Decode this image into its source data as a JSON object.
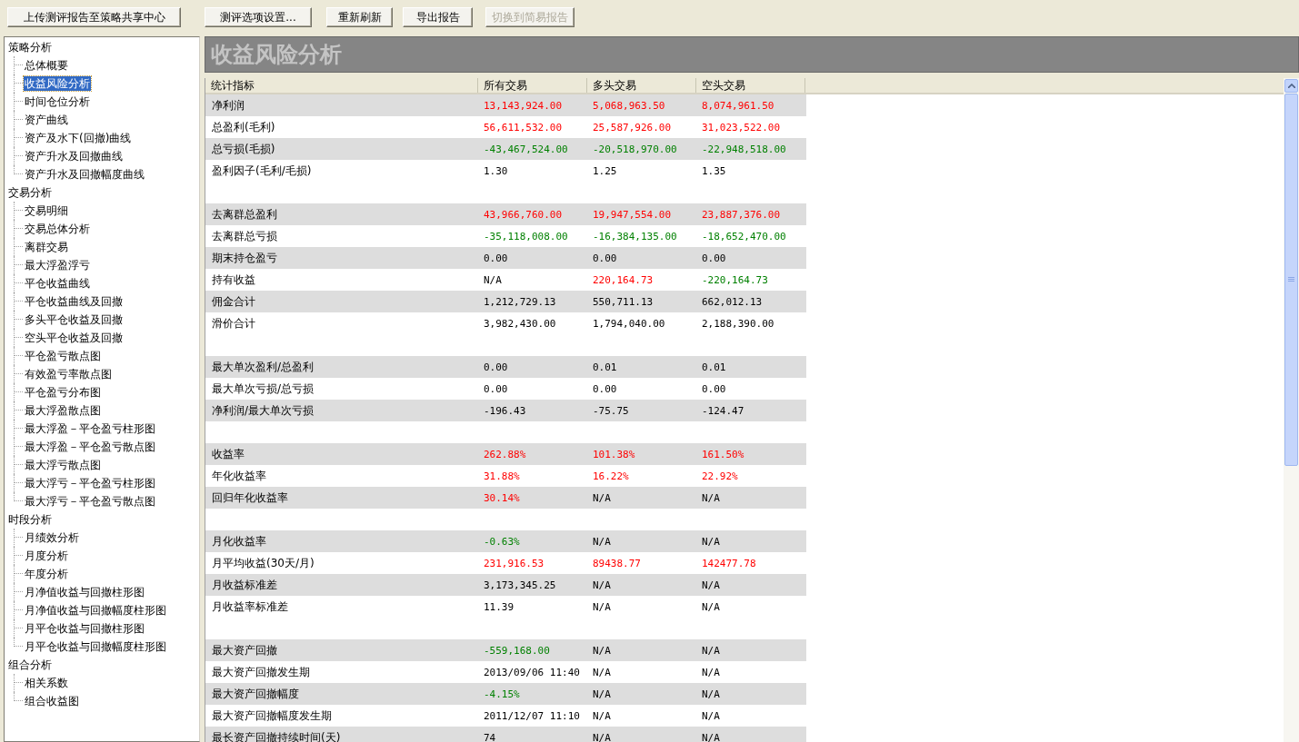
{
  "toolbar": {
    "buttons": [
      {
        "label": "上传测评报告至策略共享中心",
        "disabled": false
      },
      {
        "label": "测评选项设置...",
        "disabled": false
      },
      {
        "label": "重新刷新",
        "disabled": false
      },
      {
        "label": "导出报告",
        "disabled": false
      },
      {
        "label": "切换到简易报告",
        "disabled": true
      }
    ]
  },
  "sidebar": {
    "items": [
      {
        "label": "策略分析",
        "selected": false,
        "children": [
          {
            "label": "总体概要",
            "selected": false
          },
          {
            "label": "收益风险分析",
            "selected": true
          },
          {
            "label": "时间仓位分析",
            "selected": false
          },
          {
            "label": "资产曲线",
            "selected": false
          },
          {
            "label": "资产及水下(回撤)曲线",
            "selected": false
          },
          {
            "label": "资产升水及回撤曲线",
            "selected": false
          },
          {
            "label": "资产升水及回撤幅度曲线",
            "selected": false
          }
        ]
      },
      {
        "label": "交易分析",
        "selected": false,
        "children": [
          {
            "label": "交易明细",
            "selected": false
          },
          {
            "label": "交易总体分析",
            "selected": false
          },
          {
            "label": "离群交易",
            "selected": false
          },
          {
            "label": "最大浮盈浮亏",
            "selected": false
          },
          {
            "label": "平仓收益曲线",
            "selected": false
          },
          {
            "label": "平仓收益曲线及回撤",
            "selected": false
          },
          {
            "label": "多头平仓收益及回撤",
            "selected": false
          },
          {
            "label": "空头平仓收益及回撤",
            "selected": false
          },
          {
            "label": "平仓盈亏散点图",
            "selected": false
          },
          {
            "label": "有效盈亏率散点图",
            "selected": false
          },
          {
            "label": "平仓盈亏分布图",
            "selected": false
          },
          {
            "label": "最大浮盈散点图",
            "selected": false
          },
          {
            "label": "最大浮盈－平仓盈亏柱形图",
            "selected": false
          },
          {
            "label": "最大浮盈－平仓盈亏散点图",
            "selected": false
          },
          {
            "label": "最大浮亏散点图",
            "selected": false
          },
          {
            "label": "最大浮亏－平仓盈亏柱形图",
            "selected": false
          },
          {
            "label": "最大浮亏－平仓盈亏散点图",
            "selected": false
          }
        ]
      },
      {
        "label": "时段分析",
        "selected": false,
        "children": [
          {
            "label": "月绩效分析",
            "selected": false
          },
          {
            "label": "月度分析",
            "selected": false
          },
          {
            "label": "年度分析",
            "selected": false
          },
          {
            "label": "月净值收益与回撤柱形图",
            "selected": false
          },
          {
            "label": "月净值收益与回撤幅度柱形图",
            "selected": false
          },
          {
            "label": "月平仓收益与回撤柱形图",
            "selected": false
          },
          {
            "label": "月平仓收益与回撤幅度柱形图",
            "selected": false
          }
        ]
      },
      {
        "label": "组合分析",
        "selected": false,
        "children": [
          {
            "label": "相关系数",
            "selected": false
          },
          {
            "label": "组合收益图",
            "selected": false
          }
        ]
      }
    ]
  },
  "panel": {
    "title": "收益风险分析"
  },
  "table": {
    "columns": [
      "统计指标",
      "所有交易",
      "多头交易",
      "空头交易"
    ],
    "groups": [
      {
        "rows": [
          {
            "label": "净利润",
            "cells": [
              {
                "text": "13,143,924.00",
                "color": "#ff0000"
              },
              {
                "text": "5,068,963.50",
                "color": "#ff0000"
              },
              {
                "text": "8,074,961.50",
                "color": "#ff0000"
              }
            ]
          },
          {
            "label": "总盈利(毛利)",
            "cells": [
              {
                "text": "56,611,532.00",
                "color": "#ff0000"
              },
              {
                "text": "25,587,926.00",
                "color": "#ff0000"
              },
              {
                "text": "31,023,522.00",
                "color": "#ff0000"
              }
            ]
          },
          {
            "label": "总亏损(毛损)",
            "cells": [
              {
                "text": "-43,467,524.00",
                "color": "#008000"
              },
              {
                "text": "-20,518,970.00",
                "color": "#008000"
              },
              {
                "text": "-22,948,518.00",
                "color": "#008000"
              }
            ]
          },
          {
            "label": "盈利因子(毛利/毛损)",
            "cells": [
              {
                "text": "1.30",
                "color": "#000000"
              },
              {
                "text": "1.25",
                "color": "#000000"
              },
              {
                "text": "1.35",
                "color": "#000000"
              }
            ]
          }
        ]
      },
      {
        "rows": [
          {
            "label": "去离群总盈利",
            "cells": [
              {
                "text": "43,966,760.00",
                "color": "#ff0000"
              },
              {
                "text": "19,947,554.00",
                "color": "#ff0000"
              },
              {
                "text": "23,887,376.00",
                "color": "#ff0000"
              }
            ]
          },
          {
            "label": "去离群总亏损",
            "cells": [
              {
                "text": "-35,118,008.00",
                "color": "#008000"
              },
              {
                "text": "-16,384,135.00",
                "color": "#008000"
              },
              {
                "text": "-18,652,470.00",
                "color": "#008000"
              }
            ]
          },
          {
            "label": "期末持仓盈亏",
            "cells": [
              {
                "text": "0.00",
                "color": "#000000"
              },
              {
                "text": "0.00",
                "color": "#000000"
              },
              {
                "text": "0.00",
                "color": "#000000"
              }
            ]
          },
          {
            "label": "持有收益",
            "cells": [
              {
                "text": "N/A",
                "color": "#000000"
              },
              {
                "text": "220,164.73",
                "color": "#ff0000"
              },
              {
                "text": "-220,164.73",
                "color": "#008000"
              }
            ]
          },
          {
            "label": "佣金合计",
            "cells": [
              {
                "text": "1,212,729.13",
                "color": "#000000"
              },
              {
                "text": "550,711.13",
                "color": "#000000"
              },
              {
                "text": "662,012.13",
                "color": "#000000"
              }
            ]
          },
          {
            "label": "滑价合计",
            "cells": [
              {
                "text": "3,982,430.00",
                "color": "#000000"
              },
              {
                "text": "1,794,040.00",
                "color": "#000000"
              },
              {
                "text": "2,188,390.00",
                "color": "#000000"
              }
            ]
          }
        ]
      },
      {
        "rows": [
          {
            "label": "最大单次盈利/总盈利",
            "cells": [
              {
                "text": "0.00",
                "color": "#000000"
              },
              {
                "text": "0.01",
                "color": "#000000"
              },
              {
                "text": "0.01",
                "color": "#000000"
              }
            ]
          },
          {
            "label": "最大单次亏损/总亏损",
            "cells": [
              {
                "text": "0.00",
                "color": "#000000"
              },
              {
                "text": "0.00",
                "color": "#000000"
              },
              {
                "text": "0.00",
                "color": "#000000"
              }
            ]
          },
          {
            "label": "净利润/最大单次亏损",
            "cells": [
              {
                "text": "-196.43",
                "color": "#000000"
              },
              {
                "text": "-75.75",
                "color": "#000000"
              },
              {
                "text": "-124.47",
                "color": "#000000"
              }
            ]
          }
        ]
      },
      {
        "rows": [
          {
            "label": "收益率",
            "cells": [
              {
                "text": "262.88%",
                "color": "#ff0000"
              },
              {
                "text": "101.38%",
                "color": "#ff0000"
              },
              {
                "text": "161.50%",
                "color": "#ff0000"
              }
            ]
          },
          {
            "label": "年化收益率",
            "cells": [
              {
                "text": "31.88%",
                "color": "#ff0000"
              },
              {
                "text": "16.22%",
                "color": "#ff0000"
              },
              {
                "text": "22.92%",
                "color": "#ff0000"
              }
            ]
          },
          {
            "label": "回归年化收益率",
            "cells": [
              {
                "text": "30.14%",
                "color": "#ff0000"
              },
              {
                "text": "N/A",
                "color": "#000000"
              },
              {
                "text": "N/A",
                "color": "#000000"
              }
            ]
          }
        ]
      },
      {
        "rows": [
          {
            "label": "月化收益率",
            "cells": [
              {
                "text": "-0.63%",
                "color": "#008000"
              },
              {
                "text": "N/A",
                "color": "#000000"
              },
              {
                "text": "N/A",
                "color": "#000000"
              }
            ]
          },
          {
            "label": "月平均收益(30天/月)",
            "cells": [
              {
                "text": "231,916.53",
                "color": "#ff0000"
              },
              {
                "text": "89438.77",
                "color": "#ff0000"
              },
              {
                "text": "142477.78",
                "color": "#ff0000"
              }
            ]
          },
          {
            "label": "月收益标准差",
            "cells": [
              {
                "text": "3,173,345.25",
                "color": "#000000"
              },
              {
                "text": "N/A",
                "color": "#000000"
              },
              {
                "text": "N/A",
                "color": "#000000"
              }
            ]
          },
          {
            "label": "月收益率标准差",
            "cells": [
              {
                "text": "11.39",
                "color": "#000000"
              },
              {
                "text": "N/A",
                "color": "#000000"
              },
              {
                "text": "N/A",
                "color": "#000000"
              }
            ]
          }
        ]
      },
      {
        "rows": [
          {
            "label": "最大资产回撤",
            "cells": [
              {
                "text": "-559,168.00",
                "color": "#008000"
              },
              {
                "text": "N/A",
                "color": "#000000"
              },
              {
                "text": "N/A",
                "color": "#000000"
              }
            ]
          },
          {
            "label": "最大资产回撤发生期",
            "cells": [
              {
                "text": "2013/09/06 11:40",
                "color": "#000000"
              },
              {
                "text": "N/A",
                "color": "#000000"
              },
              {
                "text": "N/A",
                "color": "#000000"
              }
            ]
          },
          {
            "label": "最大资产回撤幅度",
            "cells": [
              {
                "text": "-4.15%",
                "color": "#008000"
              },
              {
                "text": "N/A",
                "color": "#000000"
              },
              {
                "text": "N/A",
                "color": "#000000"
              }
            ]
          },
          {
            "label": "最大资产回撤幅度发生期",
            "cells": [
              {
                "text": "2011/12/07 11:10",
                "color": "#000000"
              },
              {
                "text": "N/A",
                "color": "#000000"
              },
              {
                "text": "N/A",
                "color": "#000000"
              }
            ]
          },
          {
            "label": "最长资产回撤持续时间(天)",
            "cells": [
              {
                "text": "74",
                "color": "#000000"
              },
              {
                "text": "N/A",
                "color": "#000000"
              },
              {
                "text": "N/A",
                "color": "#000000"
              }
            ]
          }
        ]
      }
    ]
  }
}
